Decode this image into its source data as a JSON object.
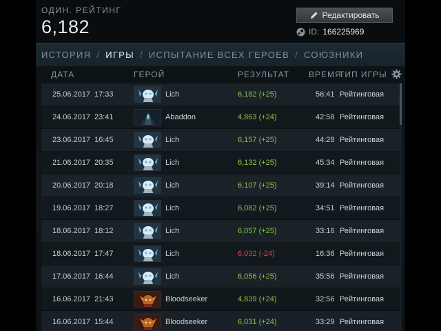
{
  "header": {
    "rating_label": "ОДИН. РЕЙТИНГ",
    "rating_value": "6,182",
    "edit_label": "Редактировать",
    "id_label": "ID:",
    "id_value": "166225969"
  },
  "tabs": [
    {
      "label": "ИСТОРИЯ",
      "active": false
    },
    {
      "label": "ИГРЫ",
      "active": true
    },
    {
      "label": "ИСПЫТАНИЕ ВСЕХ ГЕРОЕВ",
      "active": false
    },
    {
      "label": "СОЮЗНИКИ",
      "active": false
    }
  ],
  "columns": {
    "date": "ДАТА",
    "hero": "ГЕРОЙ",
    "result": "РЕЗУЛЬТАТ",
    "duration": "ВРЕМЯ",
    "type": "ТИП ИГРЫ"
  },
  "matches": [
    {
      "date": "25.06.2017",
      "time": "17:33",
      "hero": "Lich",
      "result": "6,182 (+25)",
      "outcome": "win",
      "duration": "56:41",
      "type": "Рейтинговая"
    },
    {
      "date": "24.06.2017",
      "time": "23:41",
      "hero": "Abaddon",
      "result": "4,863 (+24)",
      "outcome": "win",
      "duration": "42:58",
      "type": "Рейтинговая"
    },
    {
      "date": "23.06.2017",
      "time": "16:45",
      "hero": "Lich",
      "result": "6,157 (+25)",
      "outcome": "win",
      "duration": "44:28",
      "type": "Рейтинговая"
    },
    {
      "date": "21.06.2017",
      "time": "20:35",
      "hero": "Lich",
      "result": "6,132 (+25)",
      "outcome": "win",
      "duration": "45:34",
      "type": "Рейтинговая"
    },
    {
      "date": "20.06.2017",
      "time": "20:18",
      "hero": "Lich",
      "result": "6,107 (+25)",
      "outcome": "win",
      "duration": "39:14",
      "type": "Рейтинговая"
    },
    {
      "date": "19.06.2017",
      "time": "18:27",
      "hero": "Lich",
      "result": "6,082 (+25)",
      "outcome": "win",
      "duration": "34:51",
      "type": "Рейтинговая"
    },
    {
      "date": "18.06.2017",
      "time": "18:12",
      "hero": "Lich",
      "result": "6,057 (+25)",
      "outcome": "win",
      "duration": "33:16",
      "type": "Рейтинговая"
    },
    {
      "date": "18.06.2017",
      "time": "17:47",
      "hero": "Lich",
      "result": "6,032 (-24)",
      "outcome": "loss",
      "duration": "16:36",
      "type": "Рейтинговая"
    },
    {
      "date": "17.06.2017",
      "time": "16:44",
      "hero": "Lich",
      "result": "6,056 (+25)",
      "outcome": "win",
      "duration": "35:56",
      "type": "Рейтинговая"
    },
    {
      "date": "16.06.2017",
      "time": "21:43",
      "hero": "Bloodseeker",
      "result": "4,839 (+24)",
      "outcome": "win",
      "duration": "32:56",
      "type": "Рейтинговая"
    },
    {
      "date": "16.06.2017",
      "time": "15:44",
      "hero": "Bloodseeker",
      "result": "6,031 (+24)",
      "outcome": "win",
      "duration": "33:29",
      "type": "Рейтинговая"
    }
  ],
  "icons": {
    "edit": "pencil-icon",
    "steam": "steam-icon",
    "settings": "gear-icon"
  },
  "colors": {
    "win": "#8bc34a",
    "loss": "#e0443c"
  }
}
